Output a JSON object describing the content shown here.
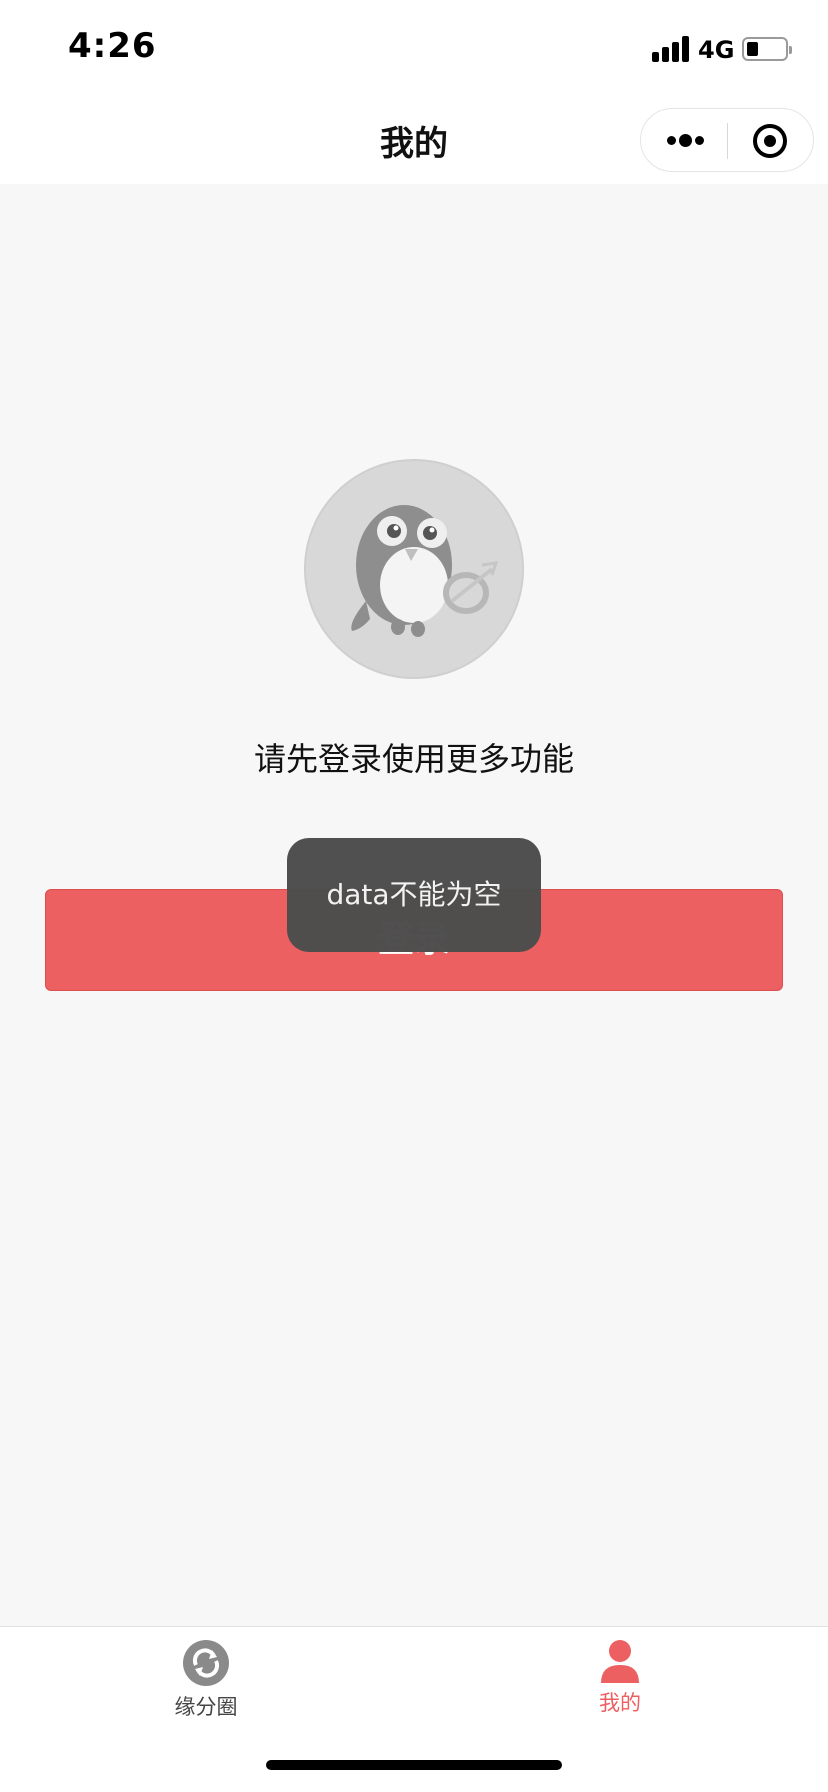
{
  "status_bar": {
    "time": "4:26",
    "network": "4G",
    "battery_level": 0.3,
    "icons": [
      "signal-icon",
      "battery-icon"
    ]
  },
  "nav_bar": {
    "title": "我的",
    "icons": [
      "more-icon",
      "close-target-icon"
    ]
  },
  "main": {
    "avatar_icon": "penguin-avatar-icon",
    "login_prompt": "请先登录使用更多功能",
    "login_button_label": "登录"
  },
  "toast": {
    "message": "data不能为空"
  },
  "tab_bar": {
    "tabs": [
      {
        "label": "缘分圈",
        "icon": "refresh-circle-icon",
        "active": false
      },
      {
        "label": "我的",
        "icon": "person-icon",
        "active": true
      }
    ]
  },
  "colors": {
    "accent": "#ec6061",
    "background": "#f7f7f7",
    "toast_background": "#4c4c4c",
    "inactive_icon": "#8a8a8a"
  }
}
